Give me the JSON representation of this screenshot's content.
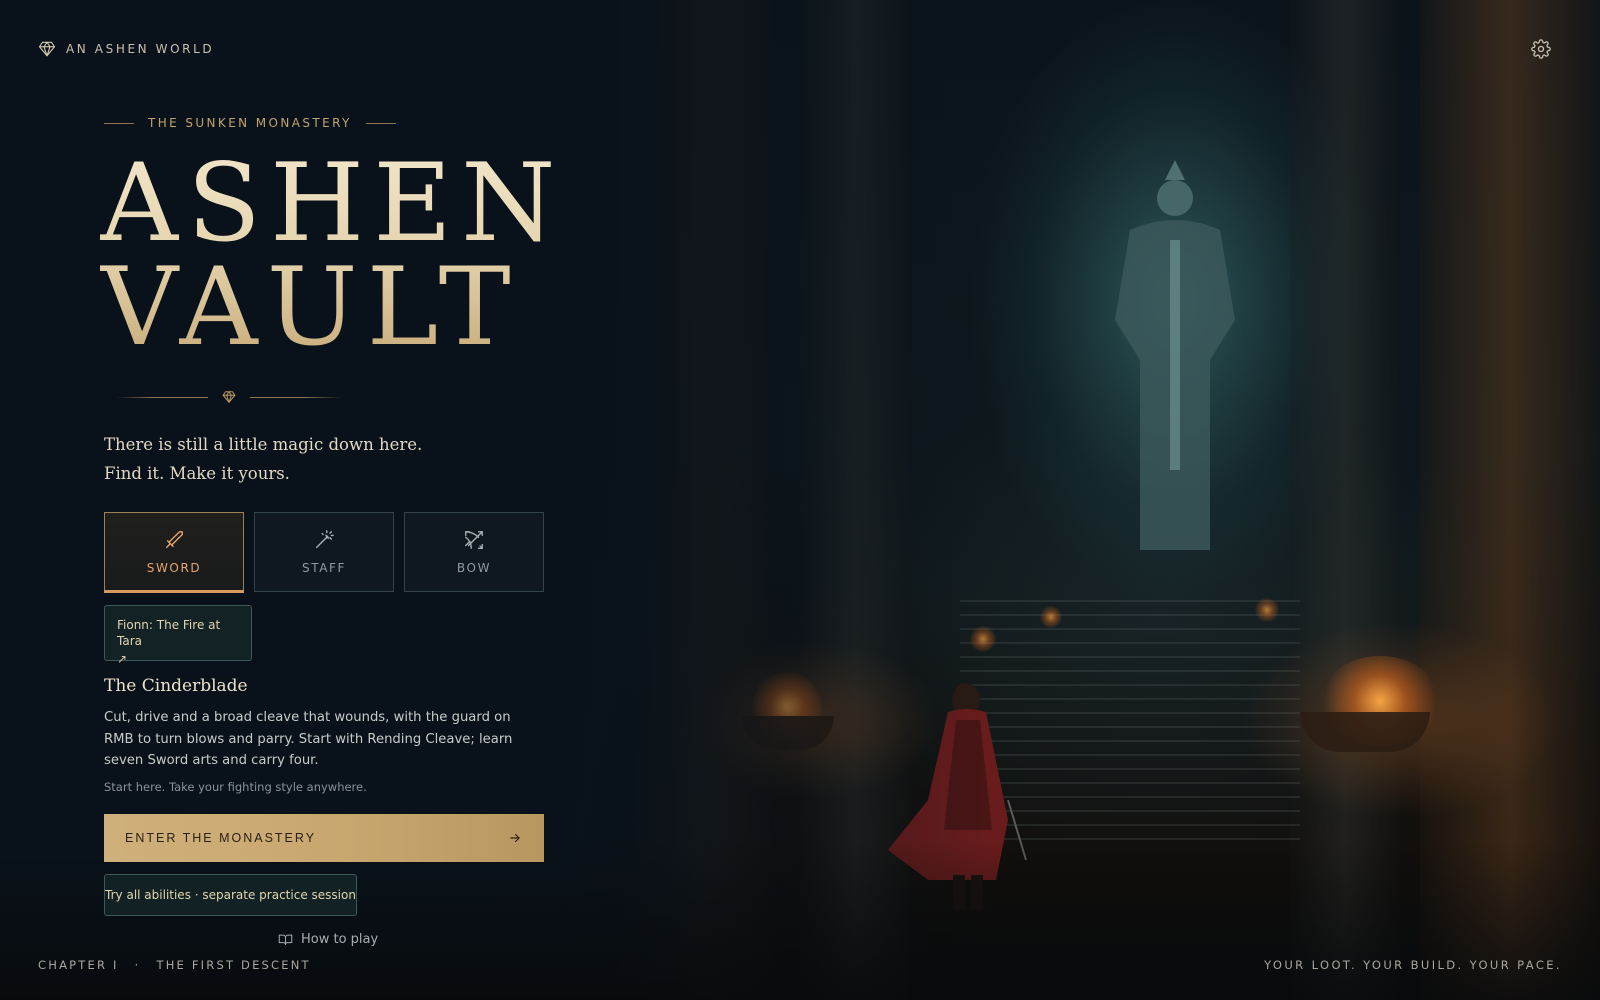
{
  "brand": {
    "name": "AN ASHEN WORLD",
    "icon": "gem-icon"
  },
  "header": {
    "settings_icon": "gear-icon"
  },
  "hero": {
    "eyebrow": "THE SUNKEN MONASTERY",
    "title_line1": "ASHEN",
    "title_line2": "VAULT",
    "tagline_line1": "There is still a little magic down here.",
    "tagline_line2": "Find it. Make it yours."
  },
  "weapons": {
    "selected": "SWORD",
    "items": [
      {
        "label": "SWORD",
        "icon": "sword-icon"
      },
      {
        "label": "STAFF",
        "icon": "magic-wand-icon"
      },
      {
        "label": "BOW",
        "icon": "bow-arrow-icon"
      }
    ]
  },
  "lore_link": {
    "label": "Fionn: The Fire at Tara",
    "icon": "arrow-up-right-icon",
    "arrow": "↗"
  },
  "weapon_info": {
    "name": "The Cinderblade",
    "description": "Cut, drive and a broad cleave that wounds, with the guard on RMB to turn blows and parry. Start with Rending Cleave; learn seven Sword arts and carry four.",
    "note": "Start here. Take your fighting style anywhere."
  },
  "actions": {
    "enter_label": "ENTER THE MONASTERY",
    "enter_icon": "arrow-right-icon",
    "practice_label": "Try all abilities · separate practice session",
    "howto_label": "How to play",
    "howto_icon": "book-icon"
  },
  "footer": {
    "chapter": "CHAPTER I",
    "separator": "·",
    "chapter_name": "THE FIRST DESCENT",
    "slogan": "YOUR LOOT. YOUR BUILD. YOUR PACE."
  },
  "colors": {
    "background": "#0a1118",
    "accent_gold": "#c8a76f",
    "active_orange": "#e6a56a",
    "teal_border": "#3d5a5a"
  }
}
